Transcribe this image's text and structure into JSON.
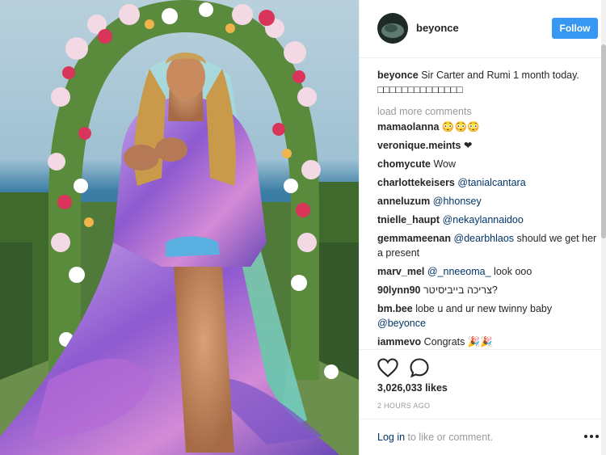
{
  "post": {
    "image_alt": "Beyoncé in floral gown holding twins in front of flower arch",
    "username": "beyonce",
    "follow_label": "Follow",
    "caption_user": "beyonce",
    "caption_text": "Sir Carter and Rumi 1 month today. □□□□□□□□□□□□□□",
    "load_more": "load more comments"
  },
  "comments": [
    {
      "user": "mamaolanna",
      "parts": [
        {
          "t": " 😳😳😳",
          "m": false
        }
      ]
    },
    {
      "user": "veronique.meints",
      "parts": [
        {
          "t": " ❤",
          "m": false
        }
      ]
    },
    {
      "user": "chomycute",
      "parts": [
        {
          "t": " Wow",
          "m": false
        }
      ]
    },
    {
      "user": "charlottekeisers",
      "parts": [
        {
          "t": " ",
          "m": false
        },
        {
          "t": "@tanialcantara",
          "m": true
        }
      ]
    },
    {
      "user": "anneluzum",
      "parts": [
        {
          "t": " ",
          "m": false
        },
        {
          "t": "@hhonsey",
          "m": true
        }
      ]
    },
    {
      "user": "tnielle_haupt",
      "parts": [
        {
          "t": " ",
          "m": false
        },
        {
          "t": "@nekaylannaidoo",
          "m": true
        }
      ]
    },
    {
      "user": "gemmameenan",
      "parts": [
        {
          "t": " ",
          "m": false
        },
        {
          "t": "@dearbhlaos",
          "m": true
        },
        {
          "t": " should we get her a present",
          "m": false
        }
      ]
    },
    {
      "user": "marv_mel",
      "parts": [
        {
          "t": " ",
          "m": false
        },
        {
          "t": "@_nneeoma_",
          "m": true
        },
        {
          "t": " look ooo",
          "m": false
        }
      ]
    },
    {
      "user": "90lynn90",
      "parts": [
        {
          "t": " צריכה בייביסיטר?",
          "m": false
        }
      ]
    },
    {
      "user": "bm.bee",
      "parts": [
        {
          "t": " lobe u and ur new twinny baby ",
          "m": false
        },
        {
          "t": "@beyonce",
          "m": true
        }
      ]
    },
    {
      "user": "iammevo",
      "parts": [
        {
          "t": " Congrats 🎉🎉",
          "m": false
        }
      ]
    },
    {
      "user": "",
      "parts": [
        {
          "t": "                           😳😳😳",
          "m": false
        }
      ]
    }
  ],
  "actions": {
    "likes": "3,026,033 likes",
    "time": "2 HOURS AGO",
    "heart_icon": "heart-outline-icon",
    "comment_icon": "comment-bubble-icon"
  },
  "footer": {
    "login_link": "Log in",
    "login_rest": " to like or comment.",
    "more_icon": "more-options-icon"
  },
  "colors": {
    "follow": "#3897f0",
    "link": "#003569",
    "muted": "#999999"
  }
}
